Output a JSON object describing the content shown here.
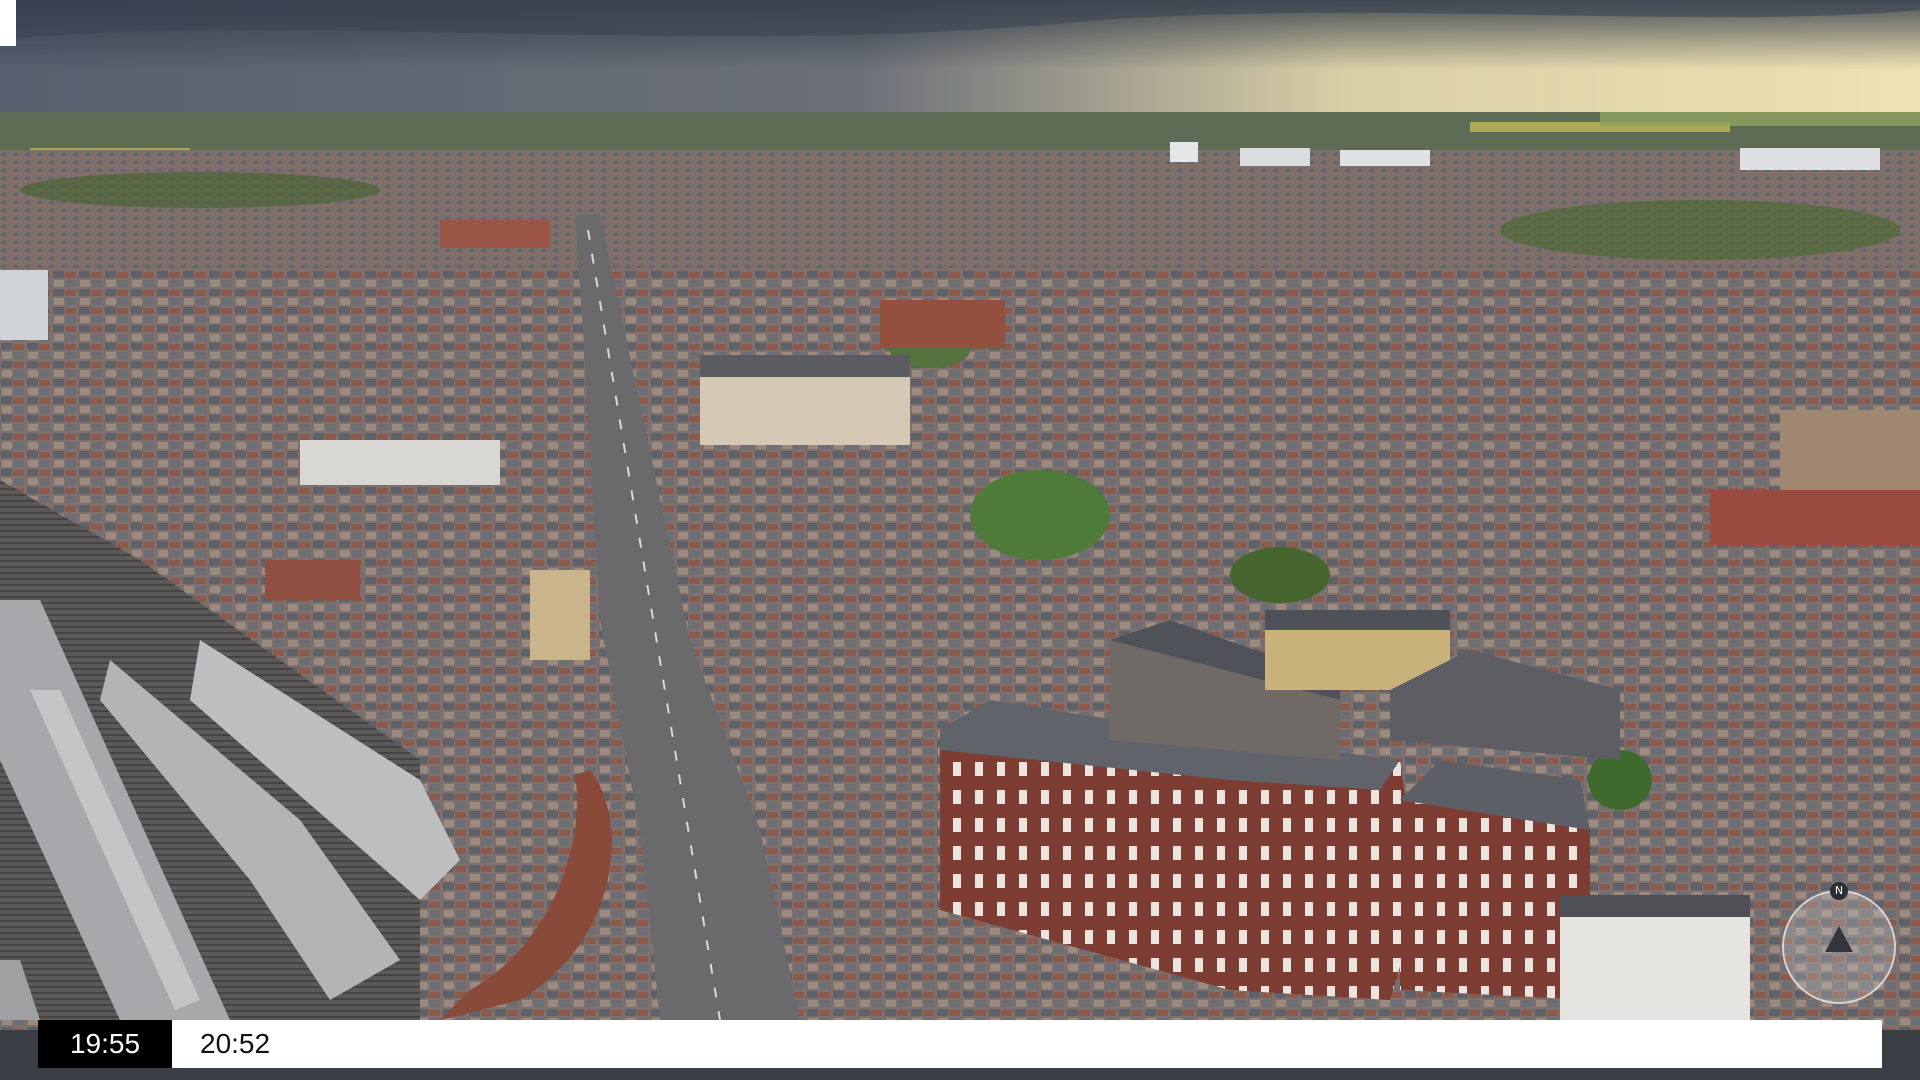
{
  "image": {
    "subject": "aerial-cityscape",
    "colors": {
      "sky_top": "#5b6675",
      "sky_glow": "#e8d9a8",
      "horizon": "#6d7a6a",
      "roofs": "#7d6f6a",
      "brick": "#8c4a3e",
      "slate": "#5f6268",
      "trees": "#4f6b3a",
      "street": "#6f6f72"
    }
  },
  "timeline": {
    "current_time": "19:55",
    "next_time": "20:52"
  },
  "compass": {
    "north_label": "N"
  }
}
